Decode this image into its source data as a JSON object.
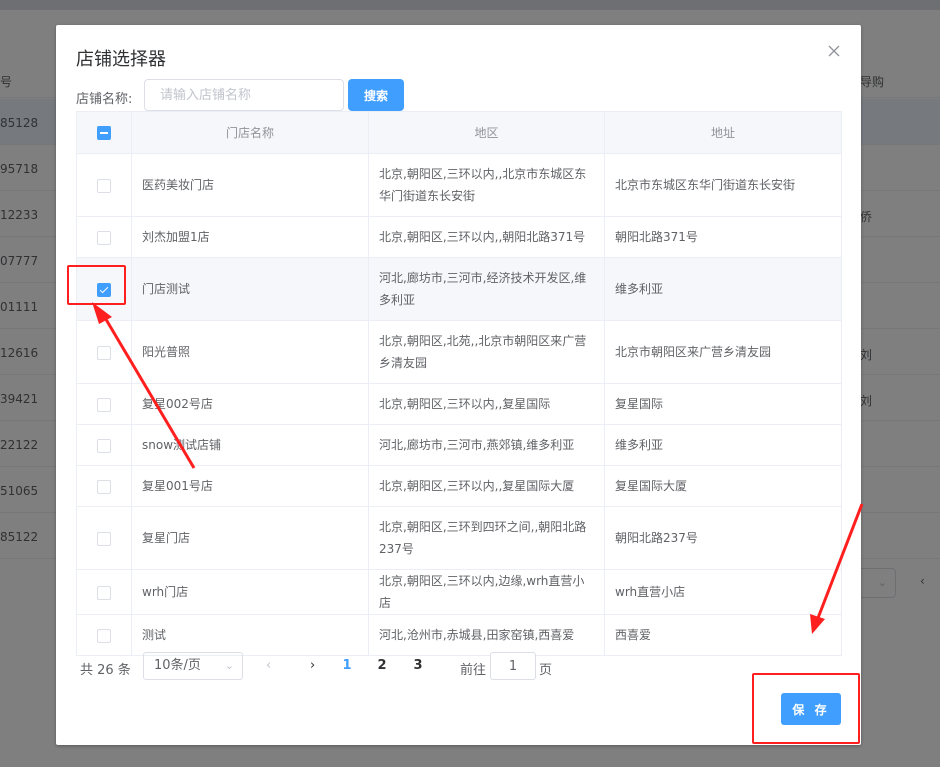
{
  "background": {
    "left_header": "号",
    "right_header": "导购",
    "rows": [
      {
        "left": "85128",
        "right": ""
      },
      {
        "left": "95718",
        "right": ""
      },
      {
        "left": "12233",
        "right": "侨"
      },
      {
        "left": "07777",
        "right": ""
      },
      {
        "left": "01111",
        "right": ""
      },
      {
        "left": "12616",
        "right": "刘"
      },
      {
        "left": "39421",
        "right": "刘"
      },
      {
        "left": "22122",
        "right": ""
      },
      {
        "left": "51065",
        "right": ""
      },
      {
        "left": "85122",
        "right": ""
      }
    ]
  },
  "dialog": {
    "title": "店铺选择器",
    "search": {
      "label": "店铺名称:",
      "placeholder": "请输入店铺名称",
      "value": "",
      "button": "搜索"
    },
    "table": {
      "columns": [
        "门店名称",
        "地区",
        "地址"
      ],
      "rows": [
        {
          "name": "医药美妆门店",
          "region": "北京,朝阳区,三环以内,,北京市东城区东华门街道东长安街",
          "address": "北京市东城区东华门街道东长安街",
          "checked": false
        },
        {
          "name": "刘杰加盟1店",
          "region": "北京,朝阳区,三环以内,,朝阳北路371号",
          "address": "朝阳北路371号",
          "checked": false
        },
        {
          "name": "门店测试",
          "region": "河北,廊坊市,三河市,经济技术开发区,维多利亚",
          "address": "维多利亚",
          "checked": true
        },
        {
          "name": "阳光普照",
          "region": "北京,朝阳区,北苑,,北京市朝阳区来广营乡清友园",
          "address": "北京市朝阳区来广营乡清友园",
          "checked": false
        },
        {
          "name": "复星002号店",
          "region": "北京,朝阳区,三环以内,,复星国际",
          "address": "复星国际",
          "checked": false
        },
        {
          "name": "snow测试店铺",
          "region": "河北,廊坊市,三河市,燕郊镇,维多利亚",
          "address": "维多利亚",
          "checked": false
        },
        {
          "name": "复星001号店",
          "region": "北京,朝阳区,三环以内,,复星国际大厦",
          "address": "复星国际大厦",
          "checked": false
        },
        {
          "name": "复星门店",
          "region": "北京,朝阳区,三环到四环之间,,朝阳北路237号",
          "address": "朝阳北路237号",
          "checked": false
        },
        {
          "name": "wrh门店",
          "region": "北京,朝阳区,三环以内,边缘,wrh直营小店",
          "address": "wrh直营小店",
          "checked": false
        },
        {
          "name": "测试",
          "region": "河北,沧州市,赤城县,田家窑镇,西喜爱",
          "address": "西喜爱",
          "checked": false
        }
      ]
    },
    "pagination": {
      "total": "共 26 条",
      "page_size": "10条/页",
      "pages": [
        "1",
        "2",
        "3"
      ],
      "current": "1",
      "goto_label": "前往",
      "goto_value": "1",
      "goto_unit": "页"
    },
    "save_button": "保 存"
  },
  "colors": {
    "primary": "#409eff",
    "annotation": "#ff1f1f"
  }
}
